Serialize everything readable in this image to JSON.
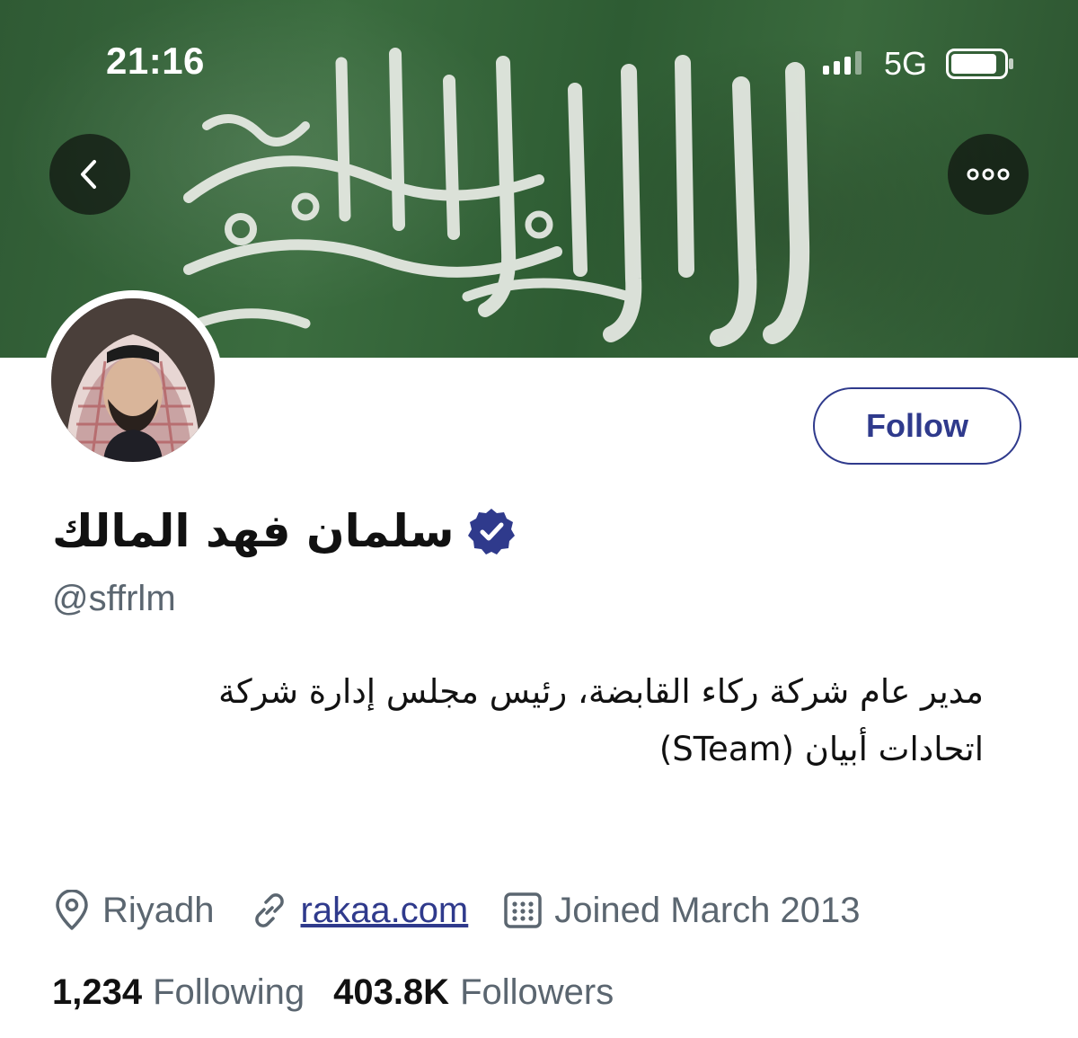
{
  "status_bar": {
    "time": "21:16",
    "network": "5G"
  },
  "icons": {
    "back": "chevron-left-icon",
    "more": "more-dots-icon",
    "location": "location-pin-icon",
    "link": "link-icon",
    "calendar": "calendar-icon",
    "verified": "verified-badge-icon"
  },
  "profile": {
    "name": "سلمان فهد المالك",
    "handle": "@sffrlm",
    "bio_line1": "مدير عام شركة ركاء القابضة، رئيس مجلس إدارة شركة",
    "bio_line2": "اتحادات أبيان (STeam)",
    "location": "Riyadh",
    "website": "rakaa.com",
    "joined": "Joined March 2013",
    "following_count": "1,234",
    "following_label": "Following",
    "followers_count": "403.8K",
    "followers_label": "Followers"
  },
  "actions": {
    "follow_label": "Follow"
  },
  "colors": {
    "accent": "#2f3a8c",
    "verified": "#2f3a8c",
    "banner": "#2f5a34",
    "muted": "#5b6670"
  }
}
